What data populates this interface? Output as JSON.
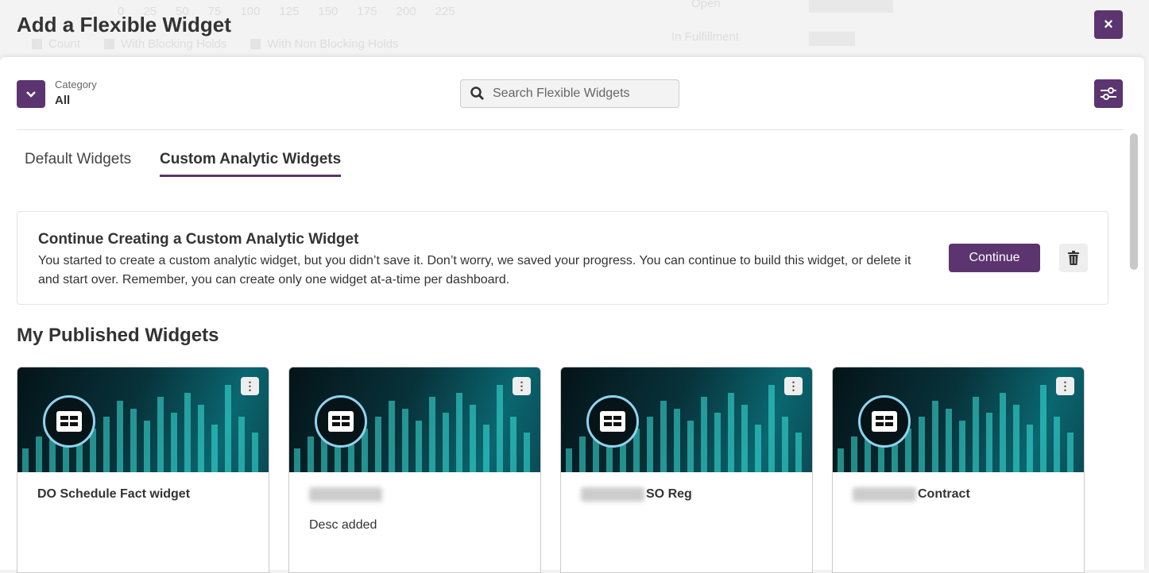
{
  "background": {
    "ticks": [
      "0",
      "25",
      "50",
      "75",
      "100",
      "125",
      "150",
      "175",
      "200",
      "225"
    ],
    "legend": [
      "Count",
      "With Blocking Holds",
      "With Non Blocking Holds"
    ],
    "rows": [
      "Open",
      "In Fulfillment"
    ]
  },
  "modal": {
    "title": "Add a Flexible Widget",
    "close_label": "×"
  },
  "category": {
    "label": "Category",
    "value": "All"
  },
  "search": {
    "placeholder": "Search Flexible Widgets"
  },
  "tabs": [
    {
      "label": "Default Widgets"
    },
    {
      "label": "Custom Analytic Widgets",
      "active": true
    }
  ],
  "banner": {
    "title": "Continue Creating a Custom Analytic Widget",
    "text": "You started to create a custom analytic widget, but you didn’t save it. Don’t worry, we saved your progress. You can continue to build this widget, or delete it and start over. Remember, you can create only one widget at-a-time per dashboard.",
    "continue_label": "Continue"
  },
  "section_title": "My Published Widgets",
  "accent": "#5c3470",
  "cards": [
    {
      "title": "DO Schedule Fact widget",
      "desc": ""
    },
    {
      "title": "",
      "desc": "Desc added"
    },
    {
      "title": "SO Reg",
      "desc": ""
    },
    {
      "title": "Contract",
      "desc": ""
    }
  ]
}
